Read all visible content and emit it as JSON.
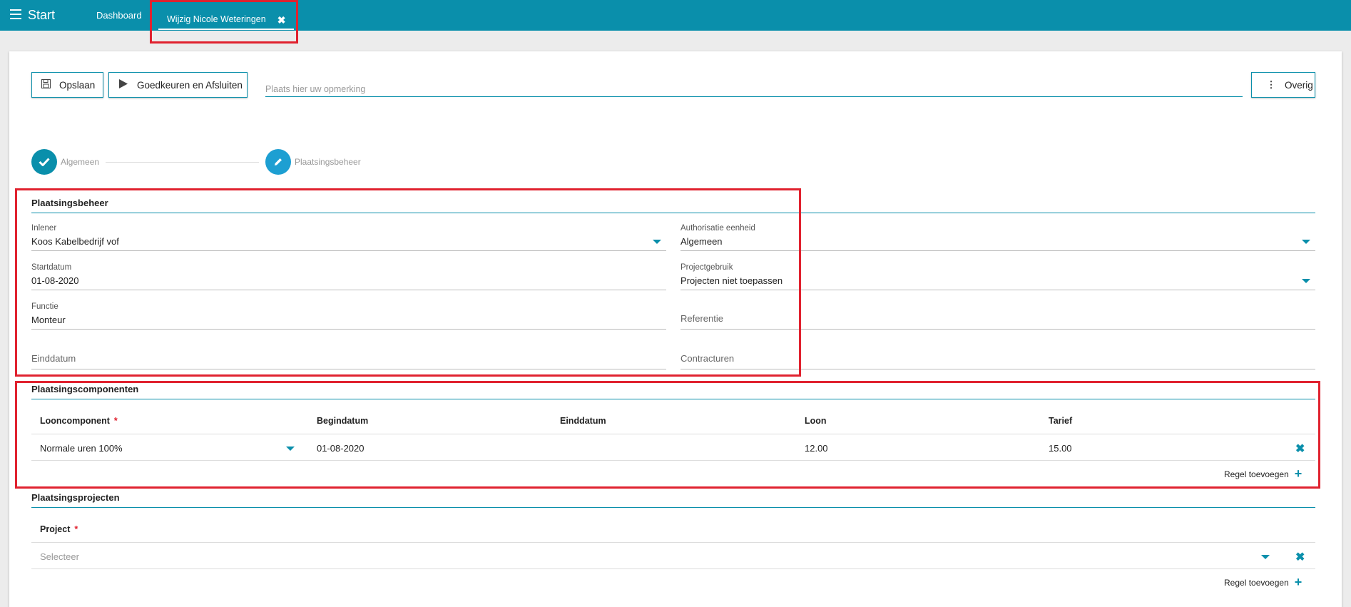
{
  "header": {
    "start_label": "Start",
    "tabs": [
      {
        "label": "Dashboard"
      },
      {
        "label": "Wijzig Nicole Weteringen",
        "close": "✖"
      }
    ]
  },
  "toolbar": {
    "save_label": "Opslaan",
    "approve_label": "Goedkeuren en Afsluiten",
    "remark_placeholder": "Plaats hier uw opmerking",
    "more_label": "Overig"
  },
  "stepper": {
    "steps": [
      {
        "label": "Algemeen",
        "icon": "check-icon"
      },
      {
        "label": "Plaatsingsbeheer",
        "icon": "pencil-icon"
      }
    ]
  },
  "plaatsingsbeheer": {
    "title": "Plaatsingsbeheer",
    "inlener": {
      "label": "Inlener",
      "value": "Koos Kabelbedrijf vof"
    },
    "startdatum": {
      "label": "Startdatum",
      "value": "01-08-2020"
    },
    "functie": {
      "label": "Functie",
      "value": "Monteur"
    },
    "einddatum": {
      "label": "Einddatum",
      "value": ""
    },
    "authorisatie": {
      "label": "Authorisatie eenheid",
      "value": "Algemeen"
    },
    "projectgebruik": {
      "label": "Projectgebruik",
      "value": "Projecten niet toepassen"
    },
    "referentie": {
      "label": "Referentie",
      "value": ""
    },
    "contracturen": {
      "label": "Contracturen",
      "value": ""
    }
  },
  "componenten": {
    "title": "Plaatsingscomponenten",
    "columns": [
      "Looncomponent",
      "Begindatum",
      "Einddatum",
      "Loon",
      "Tarief"
    ],
    "required_mark": "*",
    "rows": [
      {
        "looncomponent": "Normale uren 100%",
        "begindatum": "01-08-2020",
        "einddatum": "",
        "loon": "12.00",
        "tarief": "15.00"
      }
    ],
    "add_label": "Regel toevoegen"
  },
  "projecten": {
    "title": "Plaatsingsprojecten",
    "column": "Project",
    "required_mark": "*",
    "select_placeholder": "Selecteer",
    "add_label": "Regel toevoegen"
  },
  "colors": {
    "accent": "#0a8fab",
    "highlight": "#e0222f"
  }
}
